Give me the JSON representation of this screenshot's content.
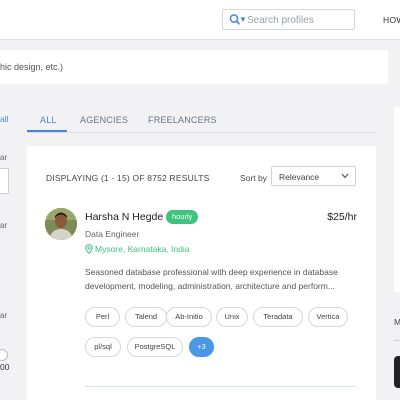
{
  "header": {
    "search_placeholder": "Search profiles",
    "nav_how": "HOW"
  },
  "main_search": {
    "hint": "hic design, etc.)"
  },
  "filters": {
    "all_label": "all",
    "label_1": "ar",
    "label_2": "ar",
    "label_3": "ar",
    "slider_value": "00"
  },
  "tabs": [
    {
      "label": "ALL",
      "active": true
    },
    {
      "label": "AGENCIES",
      "active": false
    },
    {
      "label": "FREELANCERS",
      "active": false
    }
  ],
  "results": {
    "summary": "DISPLAYING (1 - 15) OF 8752 RESULTS",
    "sort_label": "Sort by",
    "sort_value": "Relevance"
  },
  "profile": {
    "name": "Harsha N Hegde",
    "badge": "hourly",
    "rate": "$25/hr",
    "role": "Data Engineer",
    "location": "Mysore, Karnataka, India",
    "description": "Seasoned database professional with deep experience in database development, modeling, administration, architecture and perform...",
    "skills": [
      "Perl",
      "Talend",
      "Ab-Initio",
      "Unix",
      "Teradata",
      "Vertica",
      "pl/sql",
      "PostgreSQL"
    ],
    "more_skills": "+3"
  },
  "right_panel": {
    "label": "M"
  },
  "colors": {
    "accent": "#4a86d8",
    "badge_green": "#3cc47c",
    "more_button": "#4a97e8",
    "background": "#f2f2f4"
  }
}
